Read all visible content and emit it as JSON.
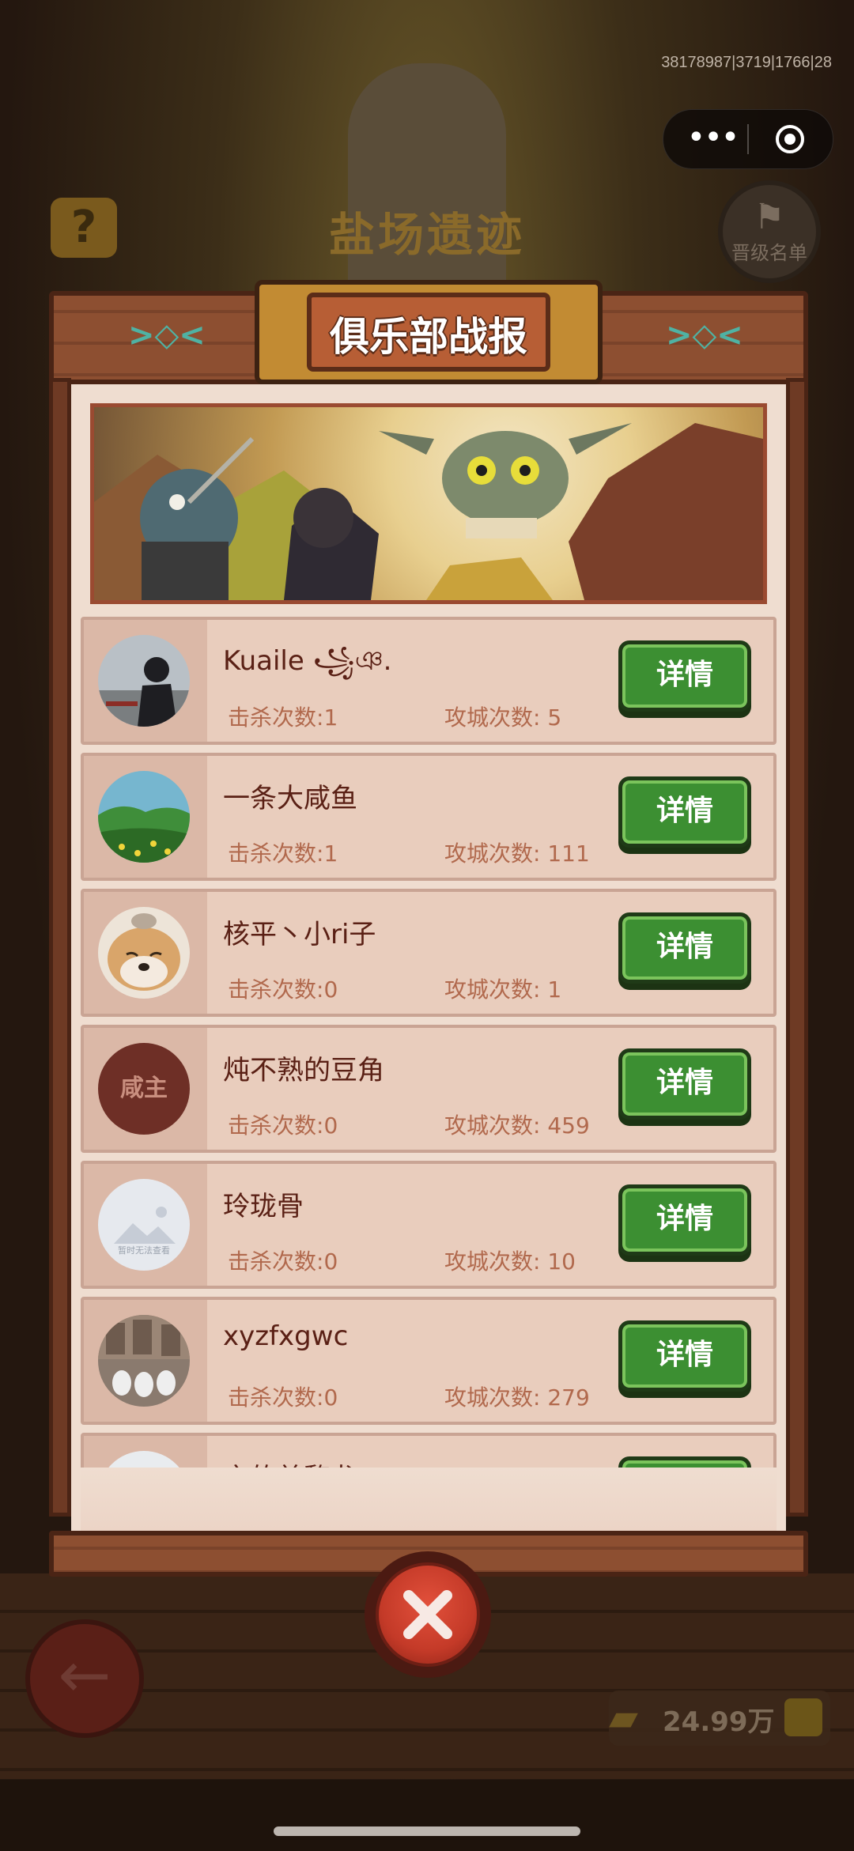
{
  "status": {
    "debug_text": "38178987|3719|1766|28"
  },
  "background": {
    "title": "盐场遗迹",
    "help_label": "?",
    "rank_label": "晋级名单",
    "coins": "24.99万"
  },
  "capsule": {
    "more_icon": "more-dots-icon",
    "close_icon": "target-close-icon"
  },
  "modal": {
    "title": "俱乐部战报",
    "detail_label": "详情",
    "kill_prefix": "击杀次数:",
    "siege_prefix": "攻城次数:"
  },
  "rows": [
    {
      "name": "Kuaile ꧁ঞ.",
      "kills": "1",
      "sieges": "5"
    },
    {
      "name": "一条大咸鱼",
      "kills": "1",
      "sieges": "111"
    },
    {
      "name": "核平丶小ri子",
      "kills": "0",
      "sieges": "1"
    },
    {
      "name": "炖不熟的豆角",
      "kills": "0",
      "sieges": "459",
      "avatar_text": "咸主"
    },
    {
      "name": "玲珑骨",
      "kills": "0",
      "sieges": "10",
      "avatar_text": "暂时无法查看"
    },
    {
      "name": "xyzfxgwc",
      "kills": "0",
      "sieges": "279"
    },
    {
      "name": "言的美黎龙",
      "kills": "",
      "sieges": ""
    }
  ],
  "colors": {
    "button_green": "#3c8f32",
    "panel_bg": "#efddd0",
    "row_bg": "#e9cdbd",
    "name_text": "#5a2015",
    "stat_text": "#b1694d",
    "close_red": "#c43a28"
  }
}
